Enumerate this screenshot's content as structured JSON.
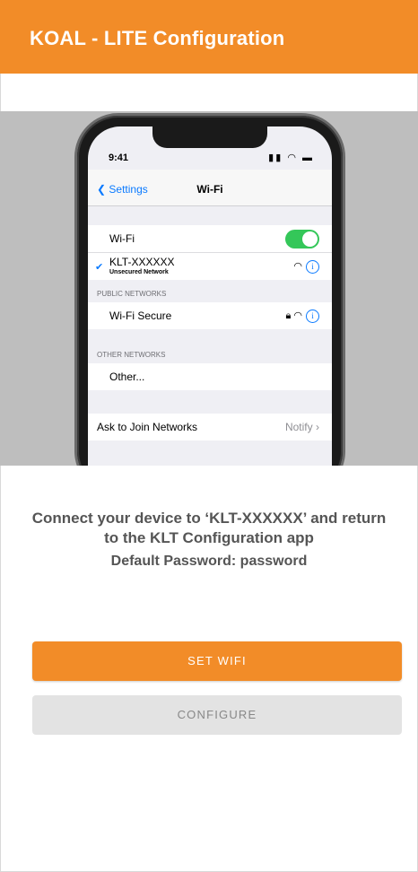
{
  "header": {
    "title": "KOAL - LITE Configuration"
  },
  "colors": {
    "accent": "#f28c28",
    "ios_blue": "#0a7aff",
    "toggle_on": "#34c759"
  },
  "phone": {
    "status_time": "9:41",
    "status_icons": "signal-wifi-battery",
    "nav_back": "Settings",
    "nav_title": "Wi-Fi",
    "wifi_label": "Wi-Fi",
    "wifi_enabled": true,
    "connected_network": "KLT-XXXXXX",
    "connected_subtitle": "Unsecured Network",
    "public_header": "PUBLIC NETWORKS",
    "public_network": "Wi-Fi Secure",
    "other_header": "OTHER NETWORKS",
    "other_label": "Other...",
    "ask_label": "Ask to Join Networks",
    "ask_value": "Notify"
  },
  "instructions": {
    "line1": "Connect your device to ‘KLT-XXXXXX’ and return",
    "line2": "to the KLT Configuration app",
    "password": "Default Password: password"
  },
  "buttons": {
    "set_wifi": "SET WIFI",
    "configure": "CONFIGURE"
  }
}
